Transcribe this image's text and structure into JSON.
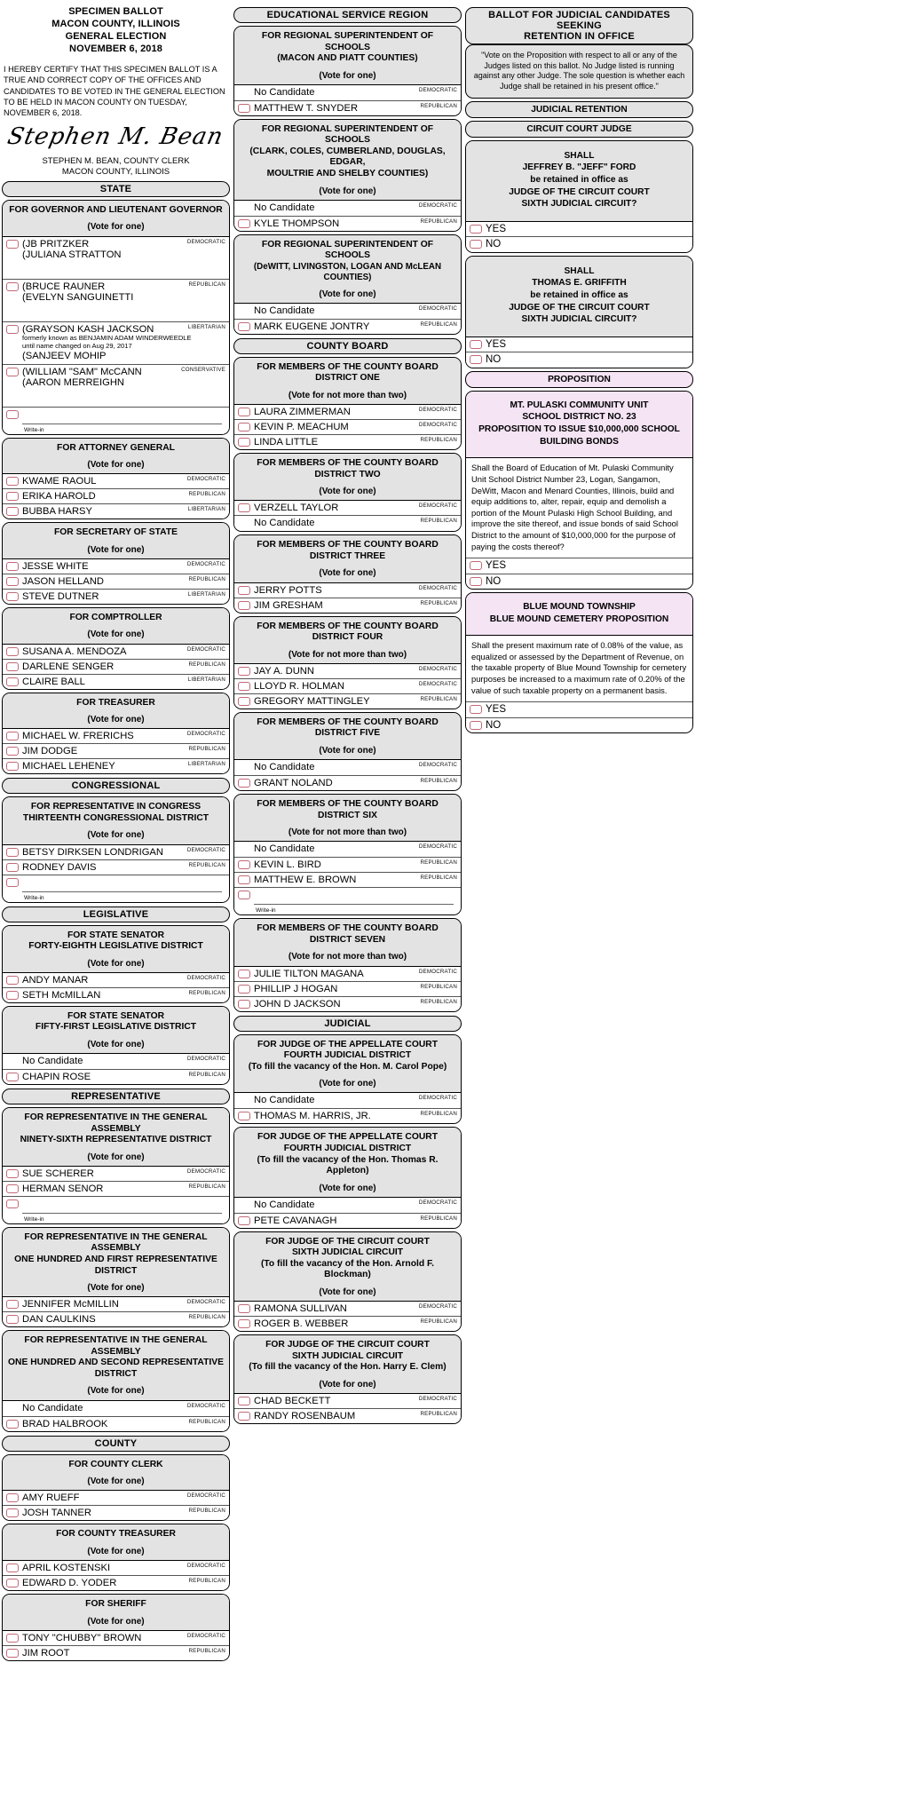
{
  "header": {
    "title_lines": [
      "SPECIMEN BALLOT",
      "MACON COUNTY, ILLINOIS",
      "GENERAL ELECTION",
      "NOVEMBER 6, 2018"
    ],
    "certification": "I HEREBY CERTIFY THAT THIS SPECIMEN BALLOT IS A TRUE AND CORRECT COPY OF THE OFFICES AND CANDIDATES TO BE VOTED IN THE GENERAL ELECTION TO BE HELD IN MACON COUNTY ON TUESDAY, NOVEMBER 6, 2018.",
    "signature": "Stephen M. Bean",
    "signature_name_line1": "STEPHEN M. BEAN, COUNTY CLERK",
    "signature_name_line2": "MACON COUNTY, ILLINOIS"
  },
  "labels": {
    "vote_for_one": "(Vote for one)",
    "vote_for_two": "(Vote for not more than two)",
    "no_candidate": "No Candidate",
    "write_in": "Write-in",
    "democratic": "DEMOCRATIC",
    "republican": "REPUBLICAN",
    "libertarian": "LIBERTARIAN",
    "conservative": "CONSERVATIVE",
    "yes": "YES",
    "no": "NO"
  },
  "colors": {
    "oval_border": "#c06a78",
    "header_gray": "#e3e3e3",
    "proposition_pink": "#f4e4f4"
  },
  "sections": {
    "state": "STATE",
    "congressional": "CONGRESSIONAL",
    "legislative": "LEGISLATIVE",
    "representative": "REPRESENTATIVE",
    "county": "COUNTY",
    "educational_service_region": "EDUCATIONAL SERVICE REGION",
    "county_board": "COUNTY BOARD",
    "judicial": "JUDICIAL",
    "judicial_retention": "JUDICIAL RETENTION",
    "circuit_court_judge": "CIRCUIT COURT JUDGE",
    "proposition": "PROPOSITION"
  },
  "contests": {
    "governor": {
      "title": "FOR GOVERNOR AND LIEUTENANT GOVERNOR",
      "vote_for": "(Vote for one)",
      "candidates": [
        {
          "line1": "(JB PRITZKER",
          "line2": "(JULIANA STRATTON",
          "party": "DEMOCRATIC",
          "tall": true
        },
        {
          "line1": "(BRUCE RAUNER",
          "line2": "(EVELYN SANGUINETTI",
          "party": "REPUBLICAN",
          "tall": true
        },
        {
          "line1": "(GRAYSON KASH JACKSON",
          "note1": "formerly known as BENJAMIN ADAM WINDERWEEDLE",
          "note2": "until name changed on Aug 29, 2017",
          "line2": "(SANJEEV MOHIP",
          "party": "LIBERTARIAN",
          "tall": true
        },
        {
          "line1": "(WILLIAM \"SAM\" McCANN",
          "line2": "(AARON MERREIGHN",
          "party": "CONSERVATIVE",
          "tall": true
        }
      ],
      "write_in": true
    },
    "attorney_general": {
      "title": "FOR ATTORNEY GENERAL",
      "vote_for": "(Vote for one)",
      "candidates": [
        {
          "line1": "KWAME RAOUL",
          "party": "DEMOCRATIC"
        },
        {
          "line1": "ERIKA HAROLD",
          "party": "REPUBLICAN"
        },
        {
          "line1": "BUBBA HARSY",
          "party": "LIBERTARIAN"
        }
      ]
    },
    "secretary_of_state": {
      "title": "FOR SECRETARY OF STATE",
      "vote_for": "(Vote for one)",
      "candidates": [
        {
          "line1": "JESSE WHITE",
          "party": "DEMOCRATIC"
        },
        {
          "line1": "JASON HELLAND",
          "party": "REPUBLICAN"
        },
        {
          "line1": "STEVE DUTNER",
          "party": "LIBERTARIAN"
        }
      ]
    },
    "comptroller": {
      "title": "FOR COMPTROLLER",
      "vote_for": "(Vote for one)",
      "candidates": [
        {
          "line1": "SUSANA A. MENDOZA",
          "party": "DEMOCRATIC"
        },
        {
          "line1": "DARLENE SENGER",
          "party": "REPUBLICAN"
        },
        {
          "line1": "CLAIRE BALL",
          "party": "LIBERTARIAN"
        }
      ]
    },
    "treasurer": {
      "title": "FOR TREASURER",
      "vote_for": "(Vote for one)",
      "candidates": [
        {
          "line1": "MICHAEL W. FRERICHS",
          "party": "DEMOCRATIC"
        },
        {
          "line1": "JIM DODGE",
          "party": "REPUBLICAN"
        },
        {
          "line1": "MICHAEL LEHENEY",
          "party": "LIBERTARIAN"
        }
      ]
    },
    "congress_13": {
      "title_line1": "FOR REPRESENTATIVE IN CONGRESS",
      "title_line2": "THIRTEENTH CONGRESSIONAL DISTRICT",
      "vote_for": "(Vote for one)",
      "candidates": [
        {
          "line1": "BETSY DIRKSEN LONDRIGAN",
          "party": "DEMOCRATIC"
        },
        {
          "line1": "RODNEY DAVIS",
          "party": "REPUBLICAN"
        }
      ],
      "write_in": true
    },
    "senator_48": {
      "title_line1": "FOR STATE SENATOR",
      "title_line2": "FORTY-EIGHTH LEGISLATIVE DISTRICT",
      "vote_for": "(Vote for one)",
      "candidates": [
        {
          "line1": "ANDY MANAR",
          "party": "DEMOCRATIC"
        },
        {
          "line1": "SETH McMILLAN",
          "party": "REPUBLICAN"
        }
      ]
    },
    "senator_51": {
      "title_line1": "FOR STATE SENATOR",
      "title_line2": "FIFTY-FIRST LEGISLATIVE DISTRICT",
      "vote_for": "(Vote for one)",
      "candidates": [
        {
          "no_candidate": true,
          "party": "DEMOCRATIC"
        },
        {
          "line1": "CHAPIN ROSE",
          "party": "REPUBLICAN"
        }
      ]
    },
    "rep_96": {
      "title_line1": "FOR REPRESENTATIVE IN THE GENERAL ASSEMBLY",
      "title_line2": "NINETY-SIXTH REPRESENTATIVE DISTRICT",
      "vote_for": "(Vote for one)",
      "candidates": [
        {
          "line1": "SUE SCHERER",
          "party": "DEMOCRATIC"
        },
        {
          "line1": "HERMAN SENOR",
          "party": "REPUBLICAN"
        }
      ],
      "write_in": true
    },
    "rep_101": {
      "title_line1": "FOR REPRESENTATIVE IN THE GENERAL ASSEMBLY",
      "title_line2": "ONE HUNDRED AND FIRST REPRESENTATIVE DISTRICT",
      "vote_for": "(Vote for one)",
      "candidates": [
        {
          "line1": "JENNIFER McMILLIN",
          "party": "DEMOCRATIC"
        },
        {
          "line1": "DAN CAULKINS",
          "party": "REPUBLICAN"
        }
      ]
    },
    "rep_102": {
      "title_line1": "FOR REPRESENTATIVE IN THE GENERAL ASSEMBLY",
      "title_line2": "ONE HUNDRED AND SECOND REPRESENTATIVE",
      "title_line3": "DISTRICT",
      "vote_for": "(Vote for one)",
      "candidates": [
        {
          "no_candidate": true,
          "party": "DEMOCRATIC"
        },
        {
          "line1": "BRAD HALBROOK",
          "party": "REPUBLICAN"
        }
      ]
    },
    "county_clerk": {
      "title": "FOR COUNTY CLERK",
      "vote_for": "(Vote for one)",
      "candidates": [
        {
          "line1": "AMY RUEFF",
          "party": "DEMOCRATIC"
        },
        {
          "line1": "JOSH TANNER",
          "party": "REPUBLICAN"
        }
      ]
    },
    "county_treasurer": {
      "title": "FOR COUNTY TREASURER",
      "vote_for": "(Vote for one)",
      "candidates": [
        {
          "line1": "APRIL KOSTENSKI",
          "party": "DEMOCRATIC"
        },
        {
          "line1": "EDWARD D. YODER",
          "party": "REPUBLICAN"
        }
      ]
    },
    "sheriff": {
      "title": "FOR SHERIFF",
      "vote_for": "(Vote for one)",
      "candidates": [
        {
          "line1": "TONY \"CHUBBY\" BROWN",
          "party": "DEMOCRATIC"
        },
        {
          "line1": "JIM ROOT",
          "party": "REPUBLICAN"
        }
      ]
    },
    "rsos_macon_piatt": {
      "title_line1": "FOR REGIONAL SUPERINTENDENT OF SCHOOLS",
      "title_line2": "(MACON AND PIATT COUNTIES)",
      "vote_for": "(Vote for one)",
      "candidates": [
        {
          "no_candidate": true,
          "party": "DEMOCRATIC"
        },
        {
          "line1": "MATTHEW T. SNYDER",
          "party": "REPUBLICAN"
        }
      ]
    },
    "rsos_clark": {
      "title_line1": "FOR REGIONAL SUPERINTENDENT OF SCHOOLS",
      "title_line2": "(CLARK, COLES, CUMBERLAND, DOUGLAS, EDGAR,",
      "title_line3": "MOULTRIE AND SHELBY COUNTIES)",
      "vote_for": "(Vote for one)",
      "candidates": [
        {
          "no_candidate": true,
          "party": "DEMOCRATIC"
        },
        {
          "line1": "KYLE THOMPSON",
          "party": "REPUBLICAN"
        }
      ]
    },
    "rsos_dewitt": {
      "title_line1": "FOR REGIONAL SUPERINTENDENT OF SCHOOLS",
      "title_line2": "(DeWITT, LIVINGSTON, LOGAN AND McLEAN COUNTIES)",
      "vote_for": "(Vote for one)",
      "candidates": [
        {
          "no_candidate": true,
          "party": "DEMOCRATIC"
        },
        {
          "line1": "MARK EUGENE JONTRY",
          "party": "REPUBLICAN"
        }
      ]
    },
    "cb_one": {
      "title_line1": "FOR MEMBERS OF THE COUNTY BOARD",
      "title_line2": "DISTRICT ONE",
      "vote_for": "(Vote for not more than two)",
      "candidates": [
        {
          "line1": "LAURA ZIMMERMAN",
          "party": "DEMOCRATIC"
        },
        {
          "line1": "KEVIN P. MEACHUM",
          "party": "DEMOCRATIC"
        },
        {
          "line1": "LINDA LITTLE",
          "party": "REPUBLICAN"
        }
      ]
    },
    "cb_two": {
      "title_line1": "FOR MEMBERS OF THE COUNTY BOARD",
      "title_line2": "DISTRICT TWO",
      "vote_for": "(Vote for one)",
      "candidates": [
        {
          "line1": "VERZELL TAYLOR",
          "party": "DEMOCRATIC"
        },
        {
          "no_candidate": true,
          "party": "REPUBLICAN"
        }
      ]
    },
    "cb_three": {
      "title_line1": "FOR MEMBERS OF THE COUNTY BOARD",
      "title_line2": "DISTRICT THREE",
      "vote_for": "(Vote for one)",
      "candidates": [
        {
          "line1": "JERRY POTTS",
          "party": "DEMOCRATIC"
        },
        {
          "line1": "JIM GRESHAM",
          "party": "REPUBLICAN"
        }
      ]
    },
    "cb_four": {
      "title_line1": "FOR MEMBERS OF THE COUNTY BOARD",
      "title_line2": "DISTRICT FOUR",
      "vote_for": "(Vote for not more than two)",
      "candidates": [
        {
          "line1": "JAY A. DUNN",
          "party": "DEMOCRATIC"
        },
        {
          "line1": "LLOYD R. HOLMAN",
          "party": "DEMOCRATIC"
        },
        {
          "line1": "GREGORY MATTINGLEY",
          "party": "REPUBLICAN"
        }
      ]
    },
    "cb_five": {
      "title_line1": "FOR MEMBERS OF THE COUNTY BOARD",
      "title_line2": "DISTRICT FIVE",
      "vote_for": "(Vote for one)",
      "candidates": [
        {
          "no_candidate": true,
          "party": "DEMOCRATIC"
        },
        {
          "line1": "GRANT NOLAND",
          "party": "REPUBLICAN"
        }
      ]
    },
    "cb_six": {
      "title_line1": "FOR MEMBERS OF THE COUNTY BOARD",
      "title_line2": "DISTRICT SIX",
      "vote_for": "(Vote for not more than two)",
      "candidates": [
        {
          "no_candidate": true,
          "party": "DEMOCRATIC"
        },
        {
          "line1": "KEVIN L. BIRD",
          "party": "REPUBLICAN"
        },
        {
          "line1": "MATTHEW E. BROWN",
          "party": "REPUBLICAN"
        }
      ],
      "write_in": true
    },
    "cb_seven": {
      "title_line1": "FOR MEMBERS OF THE COUNTY BOARD",
      "title_line2": "DISTRICT SEVEN",
      "vote_for": "(Vote for not more than two)",
      "candidates": [
        {
          "line1": "JULIE TILTON MAGANA",
          "party": "DEMOCRATIC"
        },
        {
          "line1": "PHILLIP J HOGAN",
          "party": "REPUBLICAN"
        },
        {
          "line1": "JOHN D JACKSON",
          "party": "REPUBLICAN"
        }
      ]
    },
    "appellate_pope": {
      "title_line1": "FOR JUDGE OF THE APPELLATE COURT",
      "title_line2": "FOURTH JUDICIAL DISTRICT",
      "title_line3": "(To fill the vacancy of the Hon. M. Carol Pope)",
      "vote_for": "(Vote for one)",
      "candidates": [
        {
          "no_candidate": true,
          "party": "DEMOCRATIC"
        },
        {
          "line1": "THOMAS M. HARRIS, JR.",
          "party": "REPUBLICAN"
        }
      ]
    },
    "appellate_appleton": {
      "title_line1": "FOR JUDGE OF THE APPELLATE COURT",
      "title_line2": "FOURTH JUDICIAL DISTRICT",
      "title_line3": "(To fill the vacancy of the Hon. Thomas R. Appleton)",
      "vote_for": "(Vote for one)",
      "candidates": [
        {
          "no_candidate": true,
          "party": "DEMOCRATIC"
        },
        {
          "line1": "PETE CAVANAGH",
          "party": "REPUBLICAN"
        }
      ]
    },
    "circuit_blockman": {
      "title_line1": "FOR JUDGE OF THE CIRCUIT COURT",
      "title_line2": "SIXTH JUDICIAL CIRCUIT",
      "title_line3": "(To fill the vacancy of the Hon. Arnold F. Blockman)",
      "vote_for": "(Vote for one)",
      "candidates": [
        {
          "line1": "RAMONA SULLIVAN",
          "party": "DEMOCRATIC"
        },
        {
          "line1": "ROGER B. WEBBER",
          "party": "REPUBLICAN"
        }
      ]
    },
    "circuit_clem": {
      "title_line1": "FOR JUDGE OF THE CIRCUIT COURT",
      "title_line2": "SIXTH JUDICIAL CIRCUIT",
      "title_line3": "(To fill the vacancy of the Hon. Harry E. Clem)",
      "vote_for": "(Vote for one)",
      "candidates": [
        {
          "line1": "CHAD BECKETT",
          "party": "DEMOCRATIC"
        },
        {
          "line1": "RANDY ROSENBAUM",
          "party": "REPUBLICAN"
        }
      ]
    }
  },
  "right_column": {
    "retention_title_line1": "BALLOT FOR JUDICIAL CANDIDATES SEEKING",
    "retention_title_line2": "RETENTION IN OFFICE",
    "retention_note": "\"Vote on the Proposition with respect to all or any of the Judges listed on this ballot.  No Judge listed is running against any other Judge.  The sole question is whether each Judge shall be retained in his present office.\"",
    "retentions": [
      {
        "lines": [
          "SHALL",
          "JEFFREY B. \"JEFF\" FORD",
          "be retained in office as",
          "JUDGE OF THE CIRCUIT COURT",
          "SIXTH JUDICIAL CIRCUIT?"
        ]
      },
      {
        "lines": [
          "SHALL",
          "THOMAS E. GRIFFITH",
          "be retained in office as",
          "JUDGE OF THE CIRCUIT COURT",
          "SIXTH JUDICIAL CIRCUIT?"
        ]
      }
    ],
    "propositions": [
      {
        "title_lines": [
          "MT. PULASKI COMMUNITY UNIT",
          "SCHOOL DISTRICT NO. 23",
          "PROPOSITION TO ISSUE $10,000,000 SCHOOL",
          "BUILDING BONDS"
        ],
        "body": "Shall the Board of Education of Mt. Pulaski Community Unit School District Number 23, Logan, Sangamon, DeWitt, Macon and Menard Counties, Illinois, build and equip additions to, alter, repair, equip and demolish a portion of the Mount Pulaski High School Building, and improve the site thereof, and issue bonds of said School District to the amount of $10,000,000 for the purpose of paying the costs thereof?"
      },
      {
        "title_lines": [
          "BLUE MOUND TOWNSHIP",
          "BLUE MOUND CEMETERY PROPOSITION"
        ],
        "body": "Shall the present maximum rate of 0.08% of the value, as equalized or assessed by the Department of Revenue, on the taxable property of Blue Mound Township for cemetery purposes be increased to a maximum rate of 0.20% of the value of such taxable property on a permanent basis."
      }
    ]
  }
}
